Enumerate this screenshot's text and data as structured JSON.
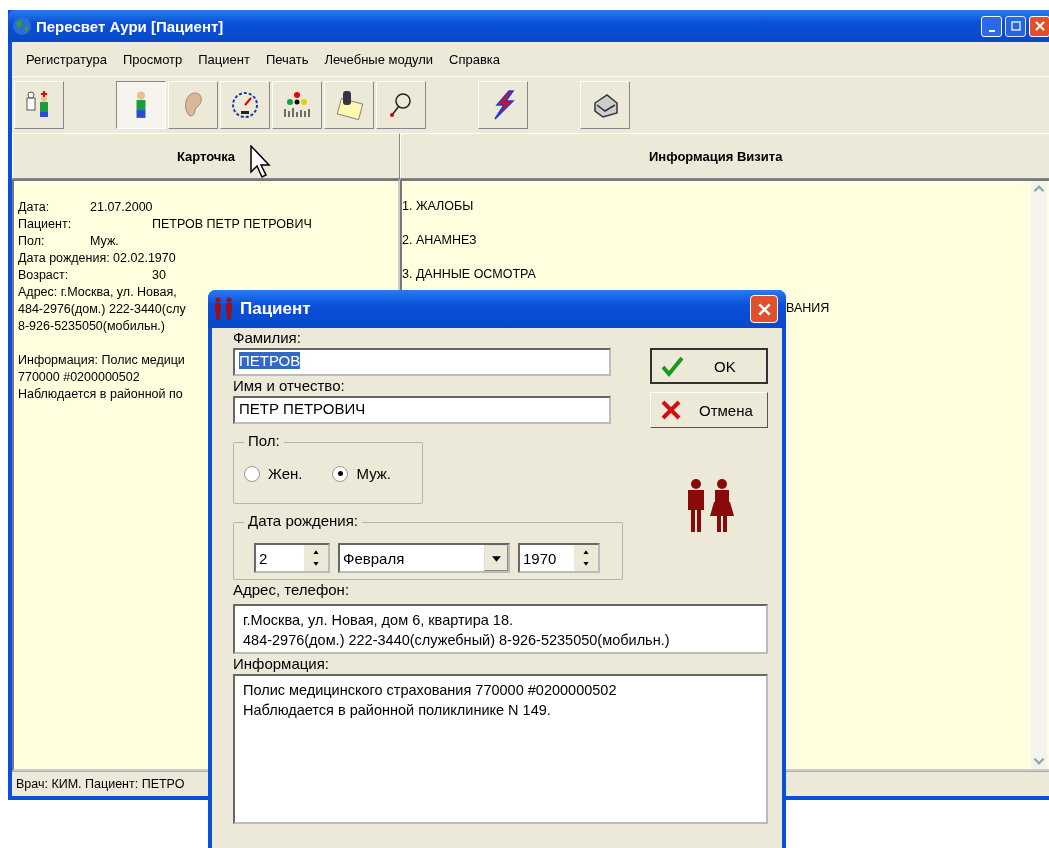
{
  "window": {
    "title": "Пересвет Аури [Пациент]"
  },
  "menu": [
    "Регистратура",
    "Просмотр",
    "Пациент",
    "Печать",
    "Лечебные модули",
    "Справка"
  ],
  "toolbar": [
    {
      "kind": "patients",
      "selected": false
    },
    {
      "kind": "person",
      "selected": true
    },
    {
      "kind": "ear",
      "selected": false
    },
    {
      "kind": "gauge",
      "selected": false
    },
    {
      "kind": "chart",
      "selected": false
    },
    {
      "kind": "notes",
      "selected": false
    },
    {
      "kind": "probe",
      "selected": false
    },
    {
      "kind": "bolt",
      "selected": false
    },
    {
      "kind": "printer",
      "selected": false
    }
  ],
  "headers": [
    "Карточка",
    "Информация Визита"
  ],
  "card": [
    {
      "kind": "pair",
      "label": "Дата:",
      "value": "21.07.2000"
    },
    {
      "kind": "pair-far",
      "label": "Пациент:",
      "value": "ПЕТРОВ ПЕТР ПЕТРОВИЧ"
    },
    {
      "kind": "pair",
      "label": "Пол:",
      "value": "Муж."
    },
    {
      "kind": "text",
      "text": "Дата рождения: 02.02.1970"
    },
    {
      "kind": "pair-far",
      "label": "Возраст:",
      "value": "30"
    },
    {
      "kind": "text",
      "text": "Адрес:  г.Москва, ул. Новая,"
    },
    {
      "kind": "text",
      "text": "484-2976(дом.) 222-3440(слу"
    },
    {
      "kind": "text",
      "text": "8-926-5235050(мобильн.)"
    },
    {
      "kind": "blank"
    },
    {
      "kind": "text",
      "text": "Информация:  Полис медици"
    },
    {
      "kind": "text",
      "text": "770000 #0200000502"
    },
    {
      "kind": "text",
      "text": "Наблюдается в районной по"
    }
  ],
  "visit": [
    {
      "kind": "item",
      "text": "1. ЖАЛОБЫ"
    },
    {
      "kind": "item",
      "text": "2. АНАМНЕЗ"
    },
    {
      "kind": "item",
      "text": "3. ДАННЫЕ ОСМОТРА"
    },
    {
      "kind": "partial",
      "text": "ВАНИЯ"
    }
  ],
  "status_bar": "Врач: КИМ.  Пациент: ПЕТРО",
  "dialog": {
    "title": "Пациент",
    "surname": {
      "label": "Фамилия:",
      "value": "ПЕТРОВ"
    },
    "name": {
      "label": "Имя и отчество:",
      "value": "ПЕТР ПЕТРОВИЧ"
    },
    "gender": {
      "label": "Пол:",
      "options": [
        {
          "label": "Жен.",
          "selected": false
        },
        {
          "label": "Муж.",
          "selected": true
        }
      ]
    },
    "birth": {
      "label": "Дата рождения:",
      "day": "2",
      "month": "Февраля",
      "year": "1970"
    },
    "address": {
      "label": "Адрес, телефон:",
      "lines": [
        "г.Москва, ул. Новая, дом 6, квартира 18.",
        "484-2976(дом.) 222-3440(служебный)  8-926-5235050(мобильн.)"
      ]
    },
    "info": {
      "label": "Информация:",
      "lines": [
        "Полис медицинского страхования  770000 #0200000502",
        "Наблюдается в районной поликлинике N 149."
      ]
    },
    "buttons": [
      {
        "kind": "ok",
        "label": "OK"
      },
      {
        "kind": "cancel",
        "label": "Отмена"
      }
    ]
  }
}
